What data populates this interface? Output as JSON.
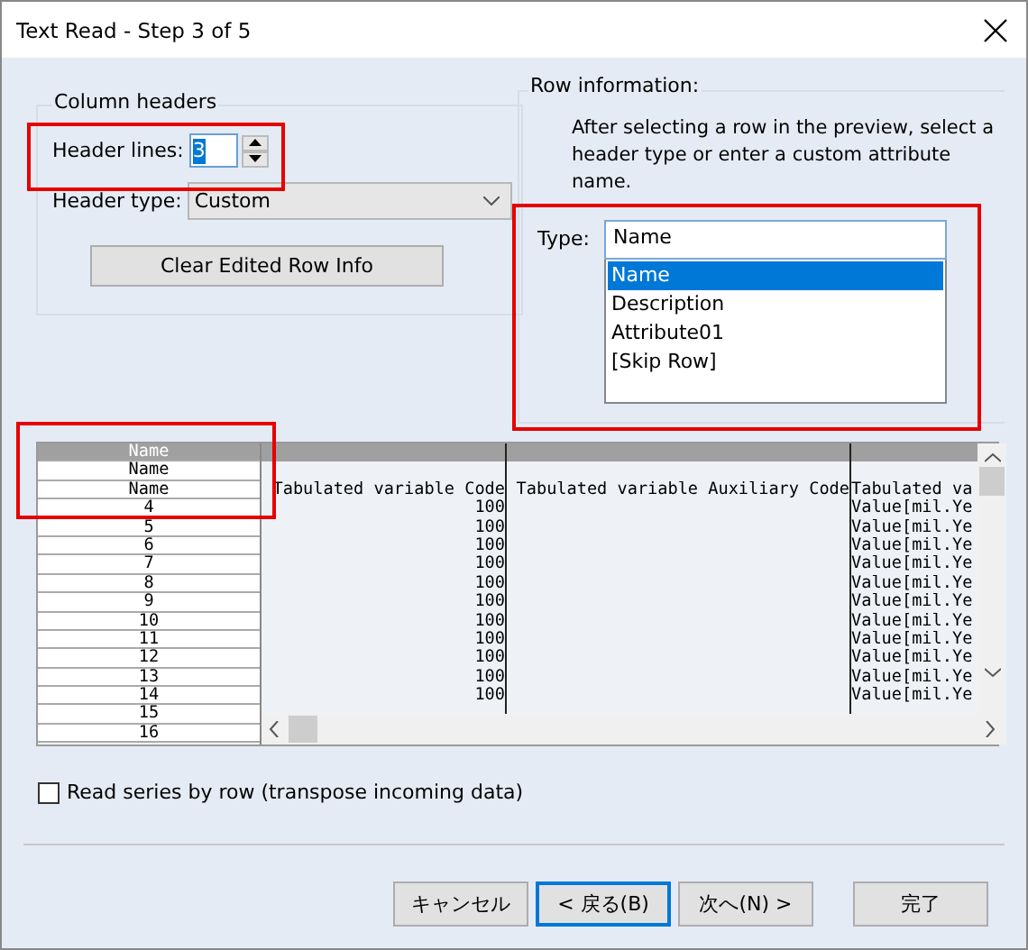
{
  "window": {
    "title": "Text Read - Step 3 of 5"
  },
  "column_headers": {
    "title": "Column headers",
    "header_lines_label": "Header lines:",
    "header_lines_value": "3",
    "header_lines_highlighted": true,
    "header_type_label": "Header type:",
    "header_type_value": "Custom",
    "clear_button": "Clear Edited Row Info"
  },
  "row_information": {
    "title": "Row information:",
    "hint": "After selecting a row in the preview, select a header type or enter a custom attribute name.",
    "type_label": "Type:",
    "type_value": "Name",
    "highlighted": true,
    "type_options": [
      {
        "label": "Name",
        "selected": true
      },
      {
        "label": "Description",
        "selected": false
      },
      {
        "label": "Attribute01",
        "selected": false
      },
      {
        "label": "[Skip Row]",
        "selected": false
      }
    ]
  },
  "preview": {
    "row_labels_highlighted": true,
    "rows": [
      {
        "label": "Name",
        "selected": true
      },
      {
        "label": "Name",
        "selected": false
      },
      {
        "label": "Name",
        "selected": false,
        "cells": {
          "column_1": "Tabulated variable Code",
          "column_2": "Tabulated variable Auxiliary Code",
          "column_3": "Tabulated va"
        }
      },
      {
        "label": "4",
        "selected": false,
        "cells": {
          "column_1": "100",
          "column_3": "Value[mil.Ye"
        }
      },
      {
        "label": "5",
        "selected": false,
        "cells": {
          "column_1": "100",
          "column_3": "Value[mil.Ye"
        }
      },
      {
        "label": "6",
        "selected": false,
        "cells": {
          "column_1": "100",
          "column_3": "Value[mil.Ye"
        }
      },
      {
        "label": "7",
        "selected": false,
        "cells": {
          "column_1": "100",
          "column_3": "Value[mil.Ye"
        }
      },
      {
        "label": "8",
        "selected": false,
        "cells": {
          "column_1": "100",
          "column_3": "Value[mil.Ye"
        }
      },
      {
        "label": "9",
        "selected": false,
        "cells": {
          "column_1": "100",
          "column_3": "Value[mil.Ye"
        }
      },
      {
        "label": "10",
        "selected": false,
        "cells": {
          "column_1": "100",
          "column_3": "Value[mil.Ye"
        }
      },
      {
        "label": "11",
        "selected": false,
        "cells": {
          "column_1": "100",
          "column_3": "Value[mil.Ye"
        }
      },
      {
        "label": "12",
        "selected": false,
        "cells": {
          "column_1": "100",
          "column_3": "Value[mil.Ye"
        }
      },
      {
        "label": "13",
        "selected": false,
        "cells": {
          "column_1": "100",
          "column_3": "Value[mil.Ye"
        }
      },
      {
        "label": "14",
        "selected": false,
        "cells": {
          "column_1": "100",
          "column_3": "Value[mil.Ye"
        }
      },
      {
        "label": "15",
        "selected": false
      },
      {
        "label": "16",
        "selected": false
      }
    ]
  },
  "transpose": {
    "label": "Read series by row (transpose incoming data)",
    "checked": false
  },
  "buttons": [
    {
      "label": "キャンセル",
      "focused": false
    },
    {
      "label": "< 戻る(B)",
      "focused": true
    },
    {
      "label": "次へ(N) >",
      "focused": false
    },
    {
      "label": "完了",
      "focused": false
    }
  ]
}
